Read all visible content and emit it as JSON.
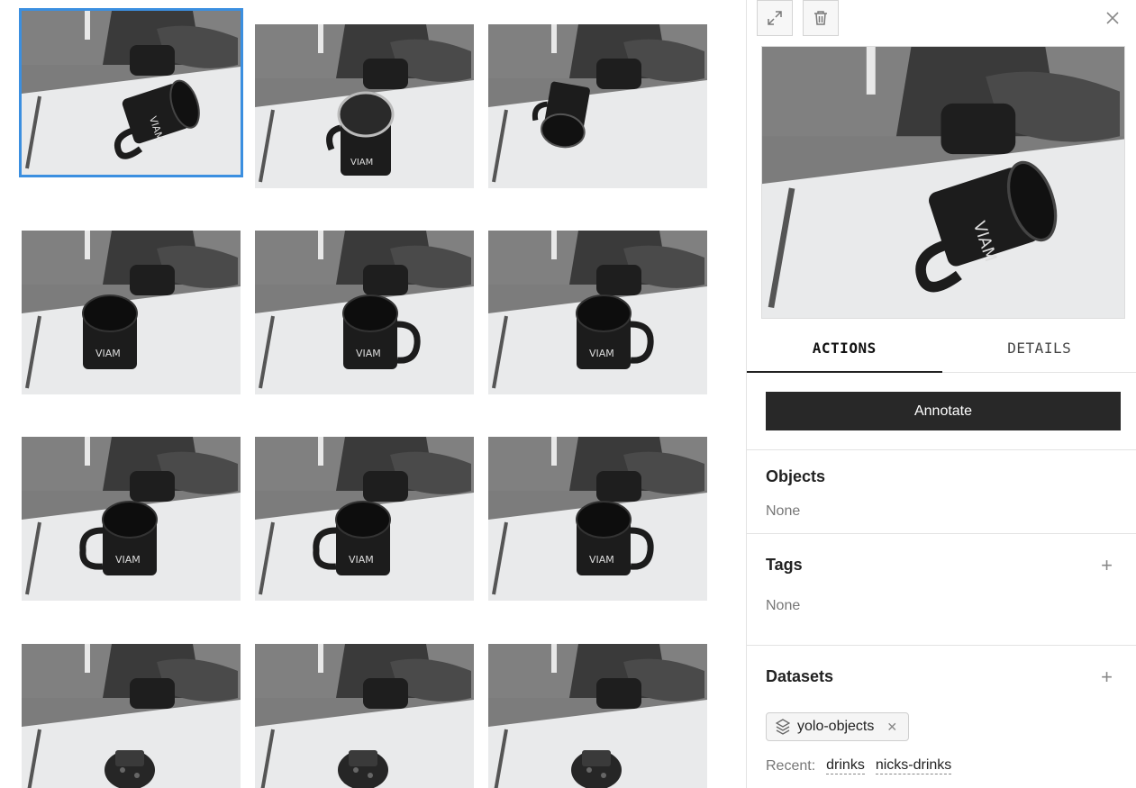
{
  "gallery": {
    "items": [
      {
        "label": "",
        "mug": "tilted",
        "selected": true
      },
      {
        "label": "",
        "mug": "top",
        "selected": false
      },
      {
        "label": "",
        "mug": "tipped",
        "selected": false
      },
      {
        "label": "",
        "mug": "upright",
        "selected": false
      },
      {
        "label": "",
        "mug": "handle-right",
        "selected": false
      },
      {
        "label": "",
        "mug": "handle-right",
        "selected": false
      },
      {
        "label": "",
        "mug": "handle-left",
        "selected": false
      },
      {
        "label": "",
        "mug": "handle-left",
        "selected": false
      },
      {
        "label": "",
        "mug": "handle-right",
        "selected": false
      },
      {
        "label": "",
        "mug": "device",
        "selected": false
      },
      {
        "label": "",
        "mug": "device",
        "selected": false
      },
      {
        "label": "",
        "mug": "device",
        "selected": false
      }
    ],
    "mug_logo": "VIAM"
  },
  "panel": {
    "tabs": [
      {
        "label": "ACTIONS",
        "active": true
      },
      {
        "label": "DETAILS",
        "active": false
      }
    ],
    "annotate_label": "Annotate",
    "objects": {
      "title": "Objects",
      "value": "None"
    },
    "tags": {
      "title": "Tags",
      "value": "None"
    },
    "datasets": {
      "title": "Datasets",
      "chip": "yolo-objects",
      "recent_label": "Recent:",
      "recent": [
        "drinks",
        "nicks-drinks"
      ]
    }
  },
  "colors": {
    "selection": "#3b8fe0",
    "button_dark": "#282828",
    "table": "#e9eaeb",
    "carpet": "#7c7c7c",
    "mug": "#1c1c1c"
  }
}
